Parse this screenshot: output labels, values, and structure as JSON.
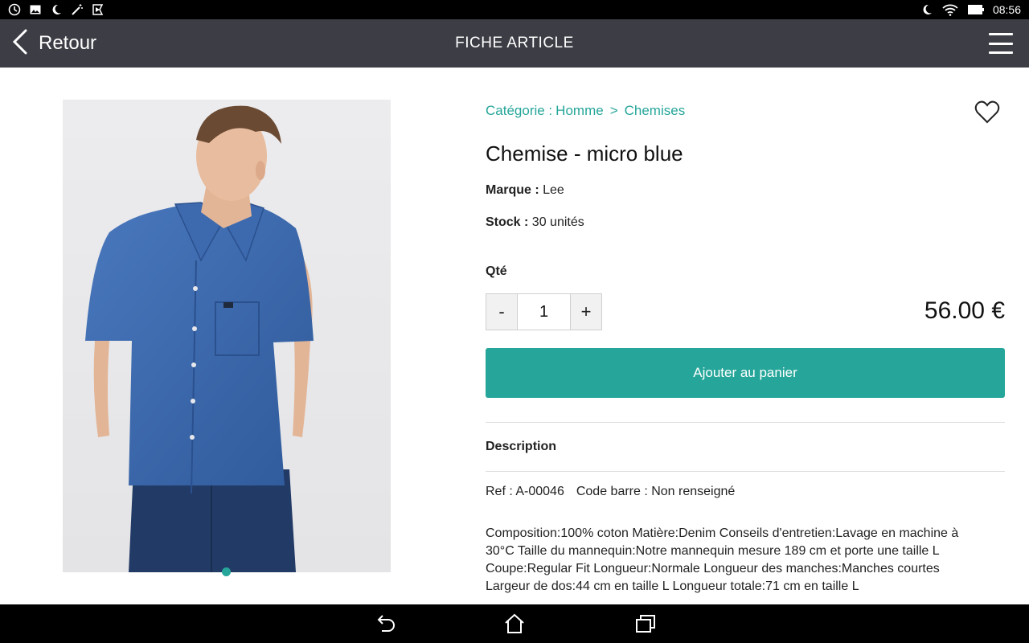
{
  "status_bar": {
    "time": "08:56",
    "left_icons": [
      "sync-icon",
      "image-icon",
      "moon-icon",
      "magic-wand-icon",
      "play-store-icon"
    ],
    "right_icons": [
      "moon-icon",
      "wifi-icon",
      "battery-icon"
    ]
  },
  "app_bar": {
    "back_label": "Retour",
    "title": "FICHE ARTICLE",
    "menu_icon": "hamburger-menu-icon"
  },
  "product": {
    "image_alt": "product-photo",
    "carousel_pages": 1,
    "carousel_active": 1,
    "breadcrumb": {
      "prefix": "Catégorie :",
      "category": "Homme",
      "separator": ">",
      "subcategory": "Chemises"
    },
    "title": "Chemise - micro blue",
    "brand_label": "Marque :",
    "brand_value": "Lee",
    "stock_label": "Stock :",
    "stock_value": "30 unités",
    "qty_label": "Qté",
    "qty_minus": "-",
    "qty_value": "1",
    "qty_plus": "+",
    "price": "56.00 €",
    "add_to_cart": "Ajouter au panier",
    "description_heading": "Description",
    "ref": "Ref : A-00046",
    "barcode": "Code barre : Non renseigné",
    "description": "Composition:100% coton Matière:Denim Conseils d'entretien:Lavage en machine à 30°C  Taille du mannequin:Notre mannequin mesure 189 cm et porte une taille L Coupe:Regular Fit Longueur:Normale Longueur des manches:Manches courtes Largeur de dos:44 cm en taille L Longueur totale:71 cm en taille L"
  },
  "colors": {
    "accent": "#26a69a",
    "app_bar": "#3d3d45",
    "shirt": "#3b67ad"
  },
  "nav_bar": {
    "icons": [
      "back-icon",
      "home-icon",
      "recent-apps-icon"
    ]
  }
}
